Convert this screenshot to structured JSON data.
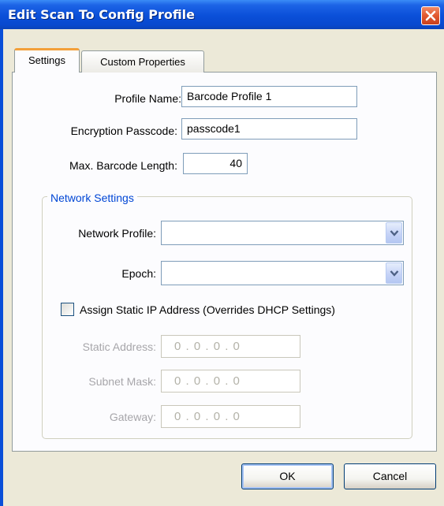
{
  "window": {
    "title": "Edit Scan To Config Profile",
    "close_icon": "close-x-icon"
  },
  "tabs": [
    {
      "label": "Settings",
      "selected": true
    },
    {
      "label": "Custom Properties",
      "selected": false
    }
  ],
  "fields": {
    "profile_name": {
      "label": "Profile Name:",
      "value": "Barcode Profile 1"
    },
    "encryption_passcode": {
      "label": "Encryption Passcode:",
      "value": "passcode1"
    },
    "max_barcode_length": {
      "label": "Max. Barcode Length:",
      "value": "40"
    }
  },
  "network": {
    "group_label": "Network Settings",
    "network_profile": {
      "label": "Network Profile:",
      "value": ""
    },
    "epoch": {
      "label": "Epoch:",
      "value": ""
    },
    "static_ip": {
      "label": "Assign Static IP Address (Overrides DHCP Settings)",
      "checked": false
    },
    "static_address": {
      "label": "Static Address:",
      "value": "0 . 0 . 0 . 0"
    },
    "subnet_mask": {
      "label": "Subnet Mask:",
      "value": "0 . 0 . 0 . 0"
    },
    "gateway": {
      "label": "Gateway:",
      "value": "0 . 0 . 0 . 0"
    }
  },
  "buttons": {
    "ok": "OK",
    "cancel": "Cancel"
  },
  "colors": {
    "titlebar": "#0a4fd8",
    "dialog_face": "#ece9d8",
    "group_caption": "#0046d5",
    "close_button": "#e2582f",
    "disabled_text": "#a7a6aa"
  }
}
